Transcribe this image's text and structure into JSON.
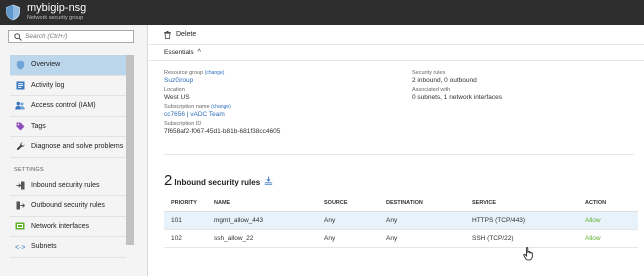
{
  "header": {
    "title": "mybigip-nsg",
    "subtitle": "Network security group",
    "icon": "shield-icon"
  },
  "sidebar": {
    "search_placeholder": "Search (Ctrl+/)",
    "items": [
      {
        "label": "Overview",
        "icon": "shield-icon",
        "active": true
      },
      {
        "label": "Activity log",
        "icon": "activity-log-icon"
      },
      {
        "label": "Access control (IAM)",
        "icon": "people-icon"
      },
      {
        "label": "Tags",
        "icon": "tag-icon"
      },
      {
        "label": "Diagnose and solve problems",
        "icon": "wrench-icon"
      }
    ],
    "settings_header": "SETTINGS",
    "settings_items": [
      {
        "label": "Inbound security rules",
        "icon": "inbound-arrow-icon"
      },
      {
        "label": "Outbound security rules",
        "icon": "outbound-arrow-icon"
      },
      {
        "label": "Network interfaces",
        "icon": "network-interface-icon"
      },
      {
        "label": "Subnets",
        "icon": "subnet-icon"
      }
    ]
  },
  "toolbar": {
    "delete_label": "Delete"
  },
  "essentials": {
    "label": "Essentials",
    "chevron": "^",
    "resource_group_label": "Resource group",
    "resource_group_change": "(change)",
    "resource_group_value": "SuzGroup",
    "location_label": "Location",
    "location_value": "West US",
    "subscription_name_label": "Subscription name",
    "subscription_name_change": "(change)",
    "subscription_name_value": "cc7656 | vADC Team",
    "subscription_id_label": "Subscription ID",
    "subscription_id_value": "7f658af2-f067-45d1-b81b-681f38cc4605",
    "security_rules_label": "Security rules",
    "security_rules_value": "2 inbound, 0 outbound",
    "associated_label": "Associated with",
    "associated_value": "0 subnets, 1 network interfaces"
  },
  "inbound": {
    "count": "2",
    "title": "Inbound security rules",
    "columns": [
      "PRIORITY",
      "NAME",
      "SOURCE",
      "DESTINATION",
      "SERVICE",
      "ACTION"
    ],
    "rows": [
      {
        "priority": "101",
        "name": "mgmt_allow_443",
        "source": "Any",
        "destination": "Any",
        "service": "HTTPS (TCP/443)",
        "action": "Allow"
      },
      {
        "priority": "102",
        "name": "ssh_allow_22",
        "source": "Any",
        "destination": "Any",
        "service": "SSH (TCP/22)",
        "action": "Allow"
      }
    ]
  },
  "colors": {
    "header_bg": "#2d2d2d",
    "active_nav": "#bcd6ec",
    "link": "#2a6ebb",
    "allow": "#5db12b"
  }
}
